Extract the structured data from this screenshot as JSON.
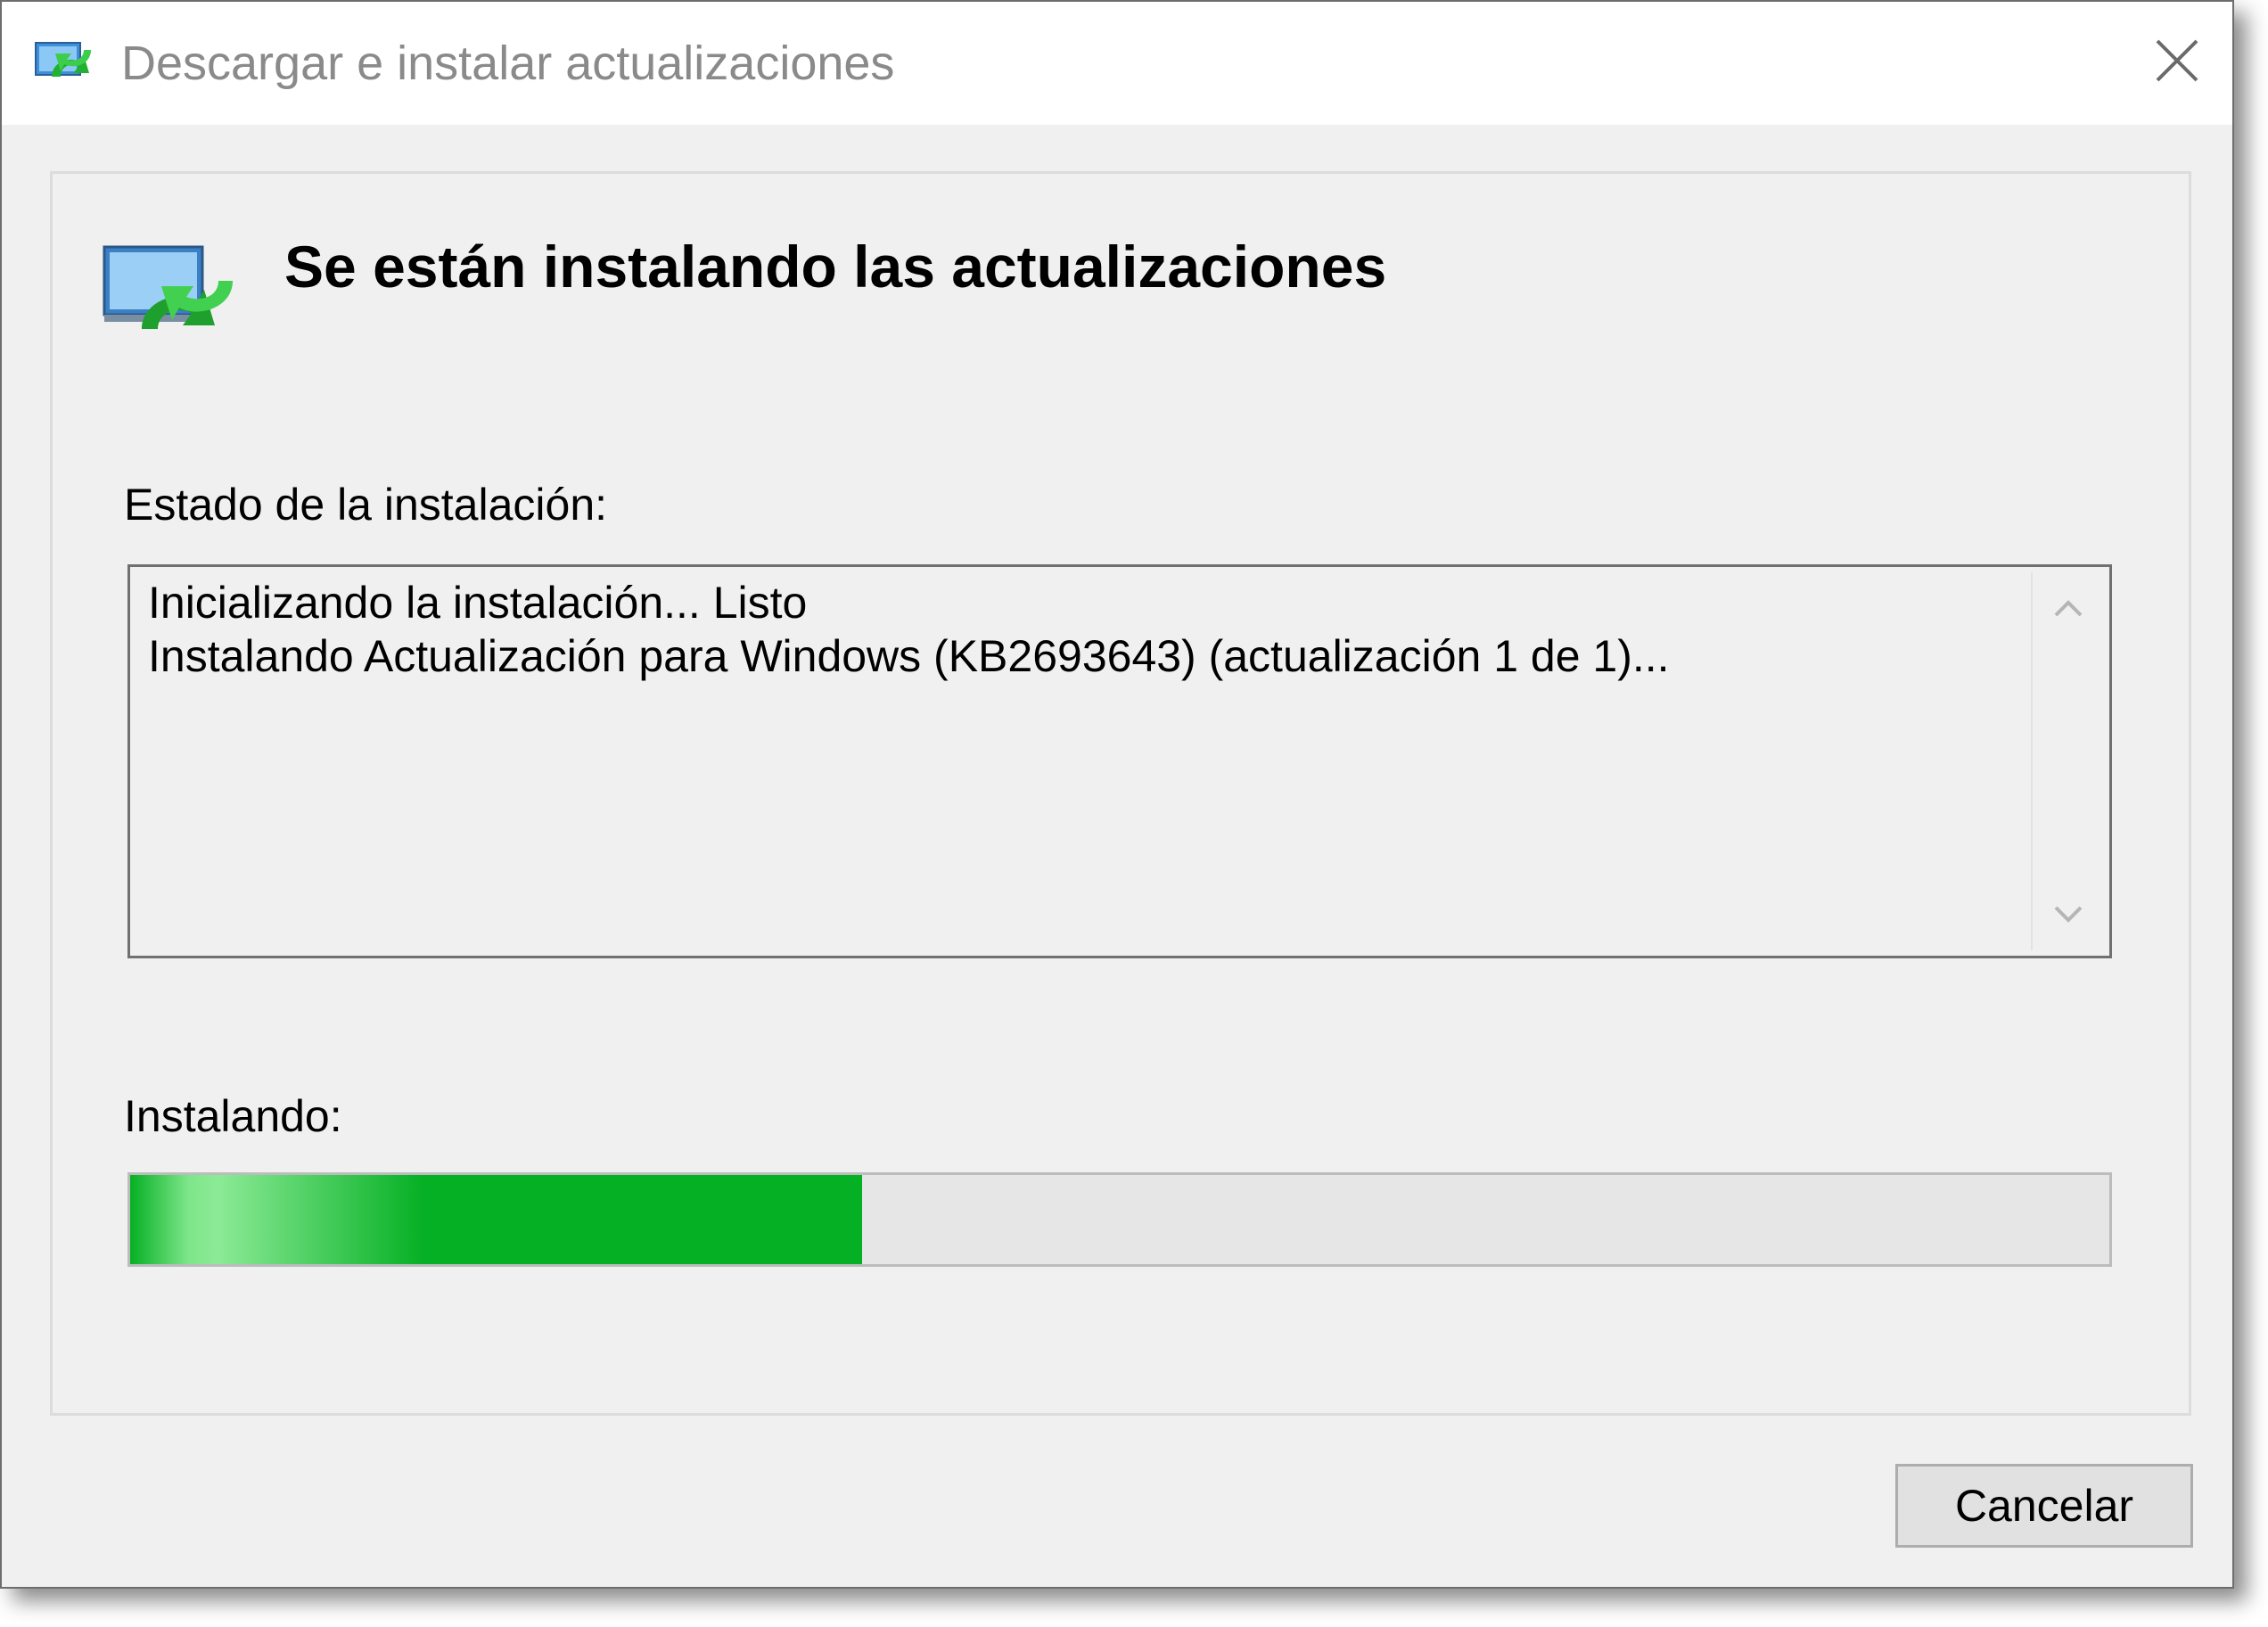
{
  "window": {
    "title": "Descargar e instalar actualizaciones",
    "title_icon": "windows-update-icon",
    "close_icon": "close-icon"
  },
  "header": {
    "icon": "windows-update-large-icon",
    "title": "Se están instalando las actualizaciones"
  },
  "status": {
    "label": "Estado de la instalación:",
    "lines": [
      "Inicializando la instalación... Listo",
      "Instalando Actualización para Windows (KB2693643) (actualización 1 de 1)..."
    ],
    "scroll_up_icon": "chevron-up-icon",
    "scroll_down_icon": "chevron-down-icon"
  },
  "progress": {
    "label": "Instalando:",
    "value_fraction": 0.37,
    "color": "#06b025"
  },
  "buttons": {
    "cancel_label": "Cancelar"
  }
}
